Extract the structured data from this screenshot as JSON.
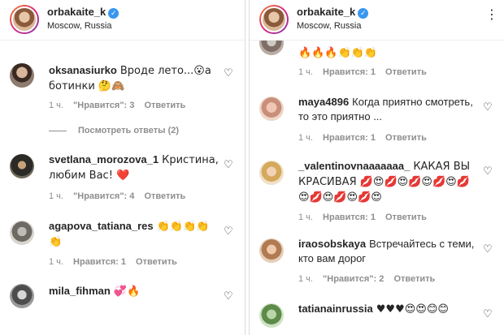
{
  "left": {
    "header": {
      "username": "orbakaite_k",
      "location": "Moscow, Russia"
    },
    "comments": [
      {
        "user": "oksanasiurko",
        "text": "Вроде лето...😮а ботинки 🤔🙈",
        "time": "1 ч.",
        "likes": "\"Нравится\": 3",
        "reply": "Ответить",
        "view_replies": "Посмотреть ответы (2)"
      },
      {
        "user": "svetlana_morozova_1",
        "text": "Кристина, любим Вас! ❤️",
        "time": "1 ч.",
        "likes": "\"Нравится\": 4",
        "reply": "Ответить"
      },
      {
        "user": "agapova_tatiana_res",
        "text": "👏👏👏👏👏",
        "time": "1 ч.",
        "likes": "Нравится: 1",
        "reply": "Ответить"
      },
      {
        "user": "mila_fihman",
        "text": "💞🔥",
        "time": "",
        "likes": "",
        "reply": ""
      }
    ]
  },
  "right": {
    "header": {
      "username": "orbakaite_k",
      "location": "Moscow, Russia"
    },
    "comments": [
      {
        "user": "",
        "text": "🔥🔥🔥👏👏👏",
        "time": "1 ч.",
        "likes": "Нравится: 1",
        "reply": "Ответить"
      },
      {
        "user": "maya4896",
        "text": "Когда приятно смотреть, то это приятно ...",
        "time": "1 ч.",
        "likes": "Нравится: 1",
        "reply": "Ответить"
      },
      {
        "user": "_valentinovnaaaaaaa_",
        "text": "КАКАЯ ВЫ КРАСИВАЯ 💋😍💋😍💋😍💋😍💋😍💋😍💋😍💋😍",
        "time": "1 ч.",
        "likes": "Нравится: 1",
        "reply": "Ответить"
      },
      {
        "user": "iraosobskaya",
        "text": "Встречайтесь с теми, кто вам дорог",
        "time": "1 ч.",
        "likes": "\"Нравится\": 2",
        "reply": "Ответить"
      },
      {
        "user": "tatianainrussia",
        "text": "♥♥♥😍😍😊😊",
        "time": "",
        "likes": "",
        "reply": ""
      }
    ]
  },
  "colors": {
    "text": "#262626",
    "meta": "#8e8e8e",
    "verified": "#3897f0",
    "heart": "#ed4956"
  },
  "icons": {
    "verified": "verified-badge-icon",
    "like": "heart-outline-icon",
    "more": "more-options-icon"
  }
}
